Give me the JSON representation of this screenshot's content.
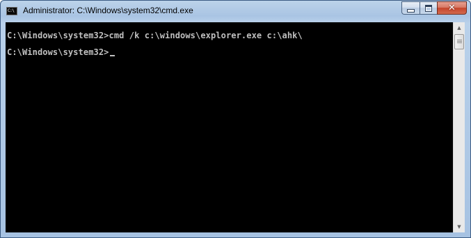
{
  "window": {
    "title": "Administrator: C:\\Windows\\system32\\cmd.exe",
    "icon_label": "C:\\",
    "icon": "cmd-console-icon",
    "buttons": {
      "minimize": "minimize-icon",
      "maximize": "maximize-icon",
      "close": "close-icon"
    }
  },
  "console": {
    "lines": [
      "C:\\Windows\\system32>cmd /k c:\\windows\\explorer.exe c:\\ahk\\",
      "C:\\Windows\\system32>"
    ],
    "text_color": "#c0c0c0",
    "background_color": "#000000"
  },
  "scrollbar": {
    "up_arrow": "▲",
    "down_arrow": "▼"
  }
}
